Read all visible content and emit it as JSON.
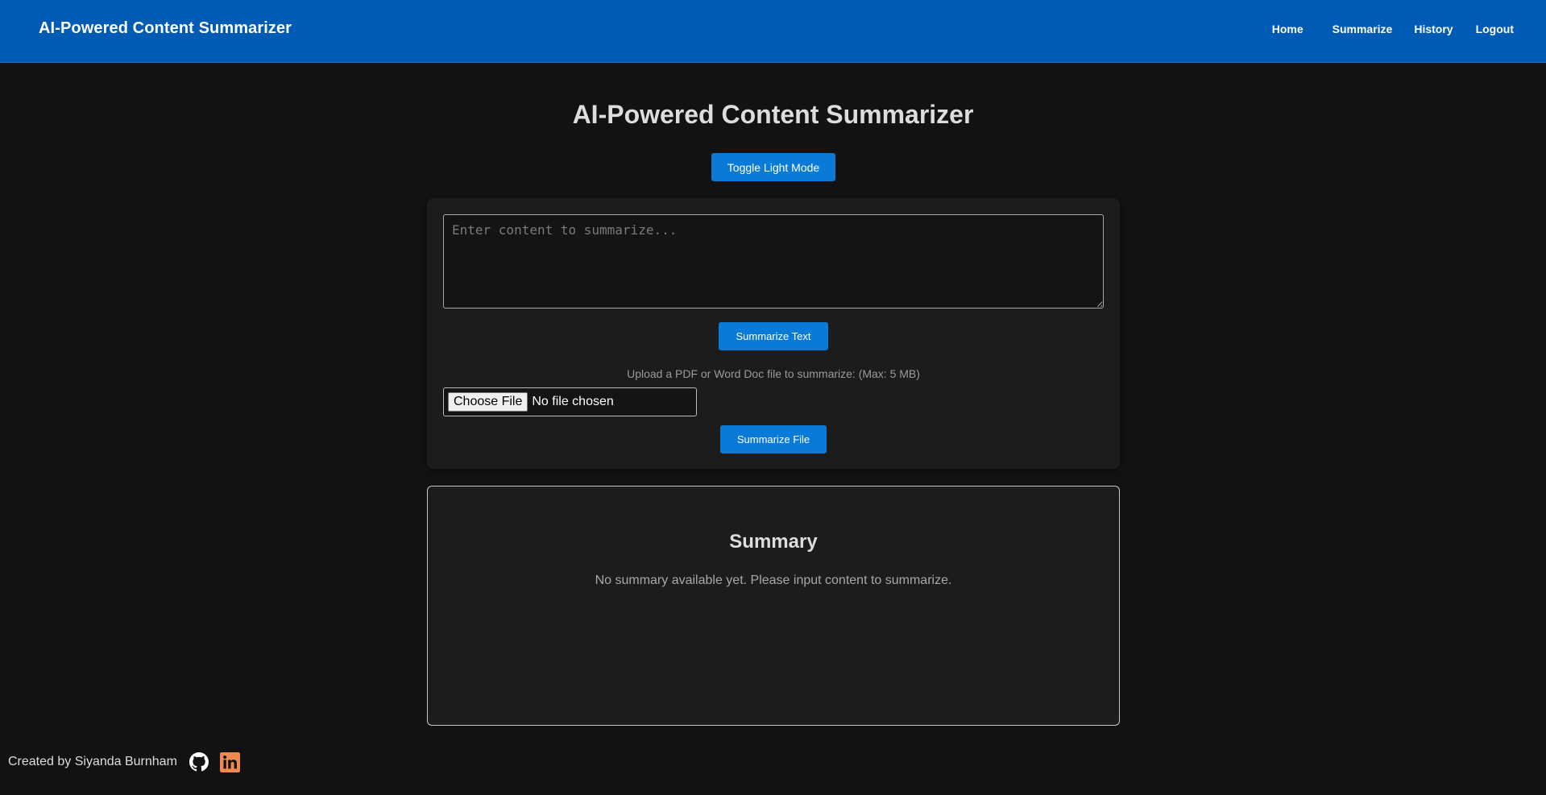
{
  "navbar": {
    "brand": "AI-Powered Content Summarizer",
    "links": [
      "Home",
      "Summarize",
      "History",
      "Logout"
    ],
    "background_color": "#005bb5"
  },
  "main": {
    "title": "AI-Powered Content Summarizer",
    "toggle_button_label": "Toggle Light Mode",
    "textarea_placeholder": "Enter content to summarize...",
    "summarize_text_label": "Summarize Text",
    "upload_label": "Upload a PDF or Word Doc file to summarize: (Max: 5 MB)",
    "choose_file_label": "Choose File",
    "file_status": "No file chosen",
    "summarize_file_label": "Summarize File",
    "accent_color": "#0a7ad8"
  },
  "summary": {
    "heading": "Summary",
    "text": "No summary available yet. Please input content to summarize."
  },
  "footer": {
    "credit": "Created by Siyanda Burnham",
    "icons": [
      "github-icon",
      "linkedin-icon"
    ],
    "linkedin_color": "#f0894e"
  }
}
